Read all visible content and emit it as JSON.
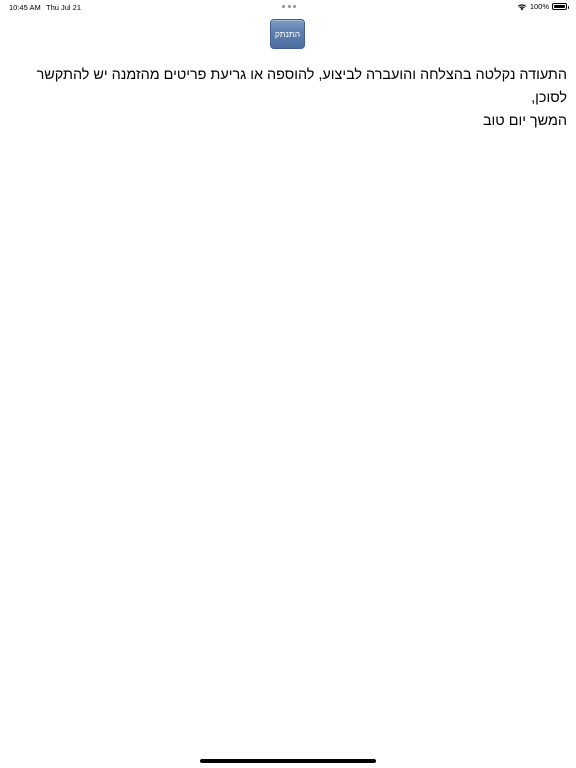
{
  "status_bar": {
    "time": "10:45 AM",
    "date": "Thu Jul 21",
    "battery_percent": "100%",
    "battery_level": 1.0,
    "wifi_icon": "wifi-icon",
    "battery_icon": "battery-icon"
  },
  "header": {
    "logout_label": "התנתק"
  },
  "content": {
    "message_line1": "התעודה נקלטה בהצלחה והועברה לביצוע, להוספה או גריעת פריטים מהזמנה יש להתקשר לסוכן,",
    "message_line2": "המשך יום טוב"
  },
  "colors": {
    "button_top": "#7d9cc4",
    "button_bottom": "#4e6f9f",
    "button_border": "#3e5f8f",
    "background": "#ffffff",
    "text": "#000000"
  }
}
